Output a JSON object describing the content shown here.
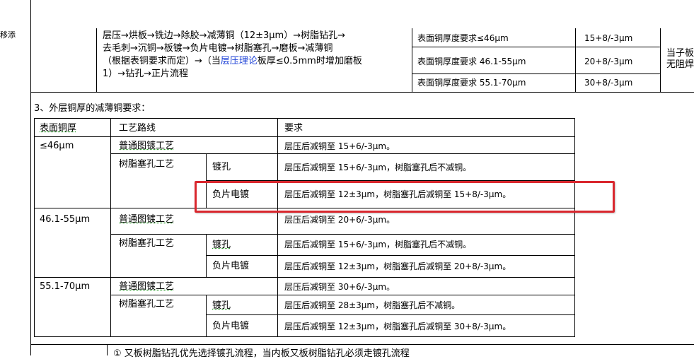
{
  "fragment_left": "移添",
  "top_section": {
    "flow_lines": [
      "层压→烘板→铣边→除胶→减薄铜（12±3μm）→树脂钻孔→",
      "去毛刺→沉铜→板镀→负片电镀→树脂塞孔→磨板→减薄铜",
      "（根据表铜要求而定）→（当层压理论板厚≤0.5mm时增加磨板",
      "1）→钻孔→正片流程"
    ],
    "flow_line3_parts": [
      "（根据表铜要求而定）→（当",
      "层压理论",
      "板厚≤0.5mm时增加磨板"
    ],
    "requirements": [
      {
        "label": "表面铜厚度要求≤46μm",
        "value": "15+8/-3μm"
      },
      {
        "label": "表面铜厚度要求 46.1-55μm",
        "value": "20+8/-3μm"
      },
      {
        "label": "表面铜厚度要求 55.1-70μm",
        "value": "30+8/-3μm"
      }
    ],
    "right_cut_lines": [
      "当子板",
      "无阻焊"
    ]
  },
  "section3_title": "3、外层铜厚的减薄铜要求：",
  "table": {
    "headers": [
      "表面铜厚",
      "工艺路线",
      "要求"
    ],
    "groups": [
      {
        "thickness": "≤46μm",
        "rows": [
          {
            "route": "普通图镀工艺",
            "sub": "",
            "req": "层压后减铜至 15+6/-3μm。"
          },
          {
            "route": "树脂塞孔工艺",
            "sub": "镀孔",
            "req": "层压后减铜至 15+6/-3μm，树脂塞孔后不减铜。"
          },
          {
            "route": "",
            "sub": "负片电镀",
            "req": "层压后减铜至 12±3μm，树脂塞孔后减铜至 15+8/-3μm。"
          }
        ]
      },
      {
        "thickness": "46.1-55μm",
        "rows": [
          {
            "route": "普通图镀工艺",
            "sub": "",
            "req": "层压后减铜至 20+6/-3μm。"
          },
          {
            "route": "树脂塞孔工艺",
            "sub": "镀孔",
            "req": "层压后减铜至 15+6/-3μm，树脂塞孔后不减铜。"
          },
          {
            "route": "",
            "sub": "负片电镀",
            "req": "层压后减铜至 12±3μm，树脂塞孔后减铜至 20+8/-3μm。"
          }
        ]
      },
      {
        "thickness": "55.1-70μm",
        "rows": [
          {
            "route": "普通图镀工艺",
            "sub": "",
            "req": "层压后减铜至 30+6/-3μm。"
          },
          {
            "route": "树脂塞孔工艺",
            "sub": "镀孔",
            "req": "层压后减铜至 28±3μm，树脂塞孔后不减铜。"
          },
          {
            "route": "",
            "sub": "负片电镀",
            "req": "层压后减铜至 12±3μm，树脂塞孔后减铜至 30+8/-3μm。"
          }
        ]
      }
    ]
  },
  "bottom_cut_text": "① 又板树脂钻孔优先选择镀孔流程，当内板又板树脂钻孔必须走镀孔流程",
  "highlight_color": "#d9272e"
}
